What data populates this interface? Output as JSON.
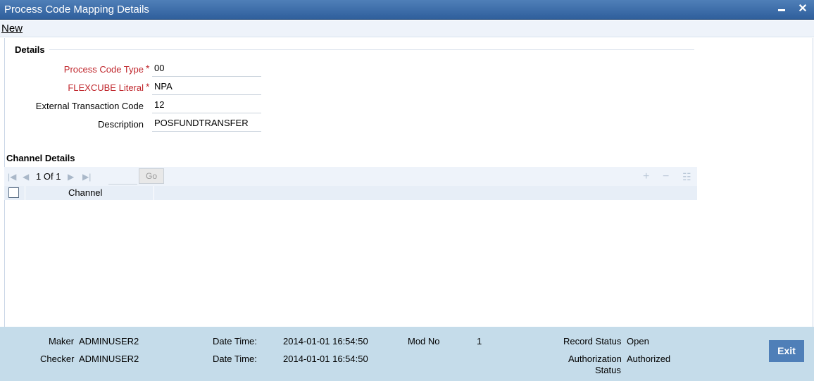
{
  "window": {
    "title": "Process Code Mapping Details"
  },
  "menu": {
    "new_label": "New"
  },
  "details": {
    "section_title": "Details",
    "fields": [
      {
        "label": "Process Code Type",
        "value": "00",
        "required": true
      },
      {
        "label": "FLEXCUBE Literal",
        "value": "NPA",
        "required": true
      },
      {
        "label": "External Transaction Code",
        "value": "12",
        "required": false
      },
      {
        "label": "Description",
        "value": "POSFUNDTRANSFER",
        "required": false
      }
    ],
    "required_marker": "*"
  },
  "channel_details": {
    "section_title": "Channel Details",
    "pagination": {
      "current": "1",
      "of_label": "Of",
      "total": "1",
      "go_label": "Go"
    },
    "columns": [
      "Channel"
    ]
  },
  "footer": {
    "maker_label": "Maker",
    "maker_value": "ADMINUSER2",
    "checker_label": "Checker",
    "checker_value": "ADMINUSER2",
    "date_time_label": "Date Time:",
    "maker_date_time": "2014-01-01 16:54:50",
    "checker_date_time": "2014-01-01 16:54:50",
    "mod_no_label": "Mod No",
    "mod_no_value": "1",
    "record_status_label": "Record Status",
    "record_status_value": "Open",
    "auth_status_label_1": "Authorization",
    "auth_status_label_2": "Status",
    "auth_status_value": "Authorized",
    "exit_label": "Exit"
  },
  "colors": {
    "titlebar": "#3a6aa8",
    "required_label": "#c0272d",
    "footer": "#c5dcea",
    "exit_button": "#4f7fb8"
  },
  "icons": [
    "minimize-icon",
    "close-icon",
    "first-page-icon",
    "prev-page-icon",
    "next-page-icon",
    "last-page-icon",
    "add-row-icon",
    "delete-row-icon",
    "view-rows-icon"
  ]
}
